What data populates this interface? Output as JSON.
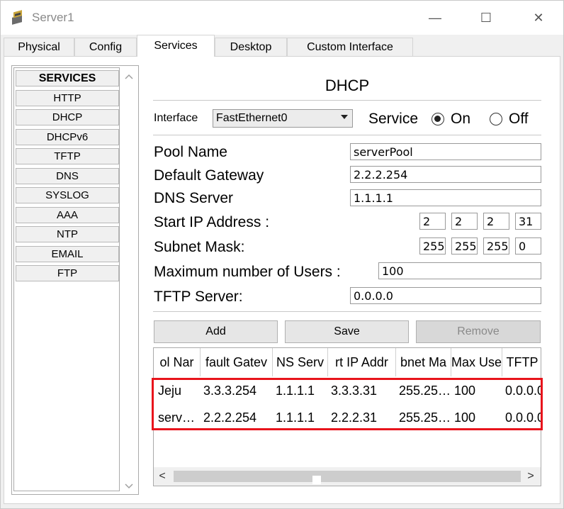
{
  "window": {
    "title": "Server1",
    "controls": {
      "minimize": "—",
      "maximize": "☐",
      "close": "✕"
    }
  },
  "tabs": [
    {
      "label": "Physical"
    },
    {
      "label": "Config"
    },
    {
      "label": "Services"
    },
    {
      "label": "Desktop"
    },
    {
      "label": "Custom Interface"
    }
  ],
  "sidebar": {
    "header": "SERVICES",
    "items": [
      {
        "label": "HTTP"
      },
      {
        "label": "DHCP"
      },
      {
        "label": "DHCPv6"
      },
      {
        "label": "TFTP"
      },
      {
        "label": "DNS"
      },
      {
        "label": "SYSLOG"
      },
      {
        "label": "AAA"
      },
      {
        "label": "NTP"
      },
      {
        "label": "EMAIL"
      },
      {
        "label": "FTP"
      }
    ]
  },
  "dhcp": {
    "title": "DHCP",
    "interface_label": "Interface",
    "interface_value": "FastEthernet0",
    "service_label": "Service",
    "on_label": "On",
    "off_label": "Off",
    "service_state": "On",
    "pool_name_label": "Pool Name",
    "pool_name_value": "serverPool",
    "gateway_label": "Default Gateway",
    "gateway_value": "2.2.2.254",
    "dns_label": "DNS Server",
    "dns_value": "1.1.1.1",
    "start_ip_label": "Start IP Address :",
    "start_ip": [
      "2",
      "2",
      "2",
      "31"
    ],
    "subnet_label": "Subnet Mask:",
    "subnet": [
      "255",
      "255",
      "255",
      "0"
    ],
    "max_users_label": "Maximum number of Users :",
    "max_users_value": "100",
    "tftp_label": "TFTP Server:",
    "tftp_value": "0.0.0.0",
    "add_button": "Add",
    "save_button": "Save",
    "remove_button": "Remove"
  },
  "pool_table": {
    "headers": [
      "ol Nar",
      "fault Gatev",
      "NS Serv",
      "rt IP Addr",
      "bnet Ma",
      "Max Use",
      "TFTP"
    ],
    "rows": [
      [
        "Jeju",
        "3.3.3.254",
        "1.1.1.1",
        "3.3.3.31",
        "255.25…",
        "100",
        "0.0.0.0"
      ],
      [
        "serv…",
        "2.2.2.254",
        "1.1.1.1",
        "2.2.2.31",
        "255.25…",
        "100",
        "0.0.0.0"
      ]
    ],
    "scroll_left": "<",
    "scroll_right": ">"
  },
  "colors": {
    "highlight": "#e8141c"
  }
}
